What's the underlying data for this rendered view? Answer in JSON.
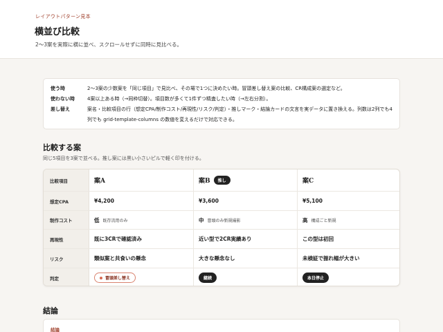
{
  "header": {
    "eyebrow": "レイアウトパターン見本",
    "title": "横並び比較",
    "lead": "2〜3案を実際に横に並べ、スクロールせずに同時に見比べる。"
  },
  "usage": [
    {
      "key": "使う時",
      "value": "2〜3案の少数案を「同じ項目」で見比べ、その場で1つに決めたい時。冒頭差し替え案の比較、CR構成案の選定など。"
    },
    {
      "key": "使わない時",
      "value": "4案以上ある時（→同枠切替）。項目数が多くて1件ずつ精査したい時（→左右分割）。"
    },
    {
      "key": "差し替え",
      "value": "案名・比較項目の行（想定CPA/制作コスト/再現性/リスク/判定）・推しマーク・結論カードの文言を実データに置き換える。列数は2列でも4列でも grid-template-columns の数値を変えるだけで対応できる。"
    }
  ],
  "compare": {
    "heading": "比較する案",
    "subtext": "同じ5項目を3案で並べる。推し案には黒い小さいピルで軽く印を付ける。",
    "header_label": "比較項目",
    "plans": [
      {
        "name": "案A",
        "badge": ""
      },
      {
        "name": "案B",
        "badge": "推し"
      },
      {
        "name": "案C",
        "badge": ""
      }
    ],
    "rows": [
      {
        "label": "想定CPA",
        "cells": [
          {
            "main": "¥4,200",
            "note": ""
          },
          {
            "main": "¥3,600",
            "note": ""
          },
          {
            "main": "¥5,100",
            "note": ""
          }
        ]
      },
      {
        "label": "制作コスト",
        "cells": [
          {
            "main": "低",
            "note": "既存流用のみ"
          },
          {
            "main": "中",
            "note": "冒頭のみ新規撮影"
          },
          {
            "main": "高",
            "note": "構成ごと新規"
          }
        ]
      },
      {
        "label": "再現性",
        "cells": [
          {
            "main": "既に3CRで確認済み",
            "note": ""
          },
          {
            "main": "近い型で2CR実績あり",
            "note": ""
          },
          {
            "main": "この型は初回",
            "note": ""
          }
        ]
      },
      {
        "label": "リスク",
        "cells": [
          {
            "main": "類似案と共食いの懸念",
            "note": ""
          },
          {
            "main": "大きな懸念なし",
            "note": ""
          },
          {
            "main": "未検証で振れ幅が大きい",
            "note": ""
          }
        ]
      }
    ],
    "verdict": {
      "label": "判定",
      "values": [
        "冒頭差し替え",
        "継続",
        "本日停止"
      ]
    }
  },
  "conclusion": {
    "heading": "結論",
    "label": "結論"
  },
  "colors": {
    "accent": "#a0412d",
    "dark_pill": "#222222",
    "outline_pill": "#d9826e"
  }
}
